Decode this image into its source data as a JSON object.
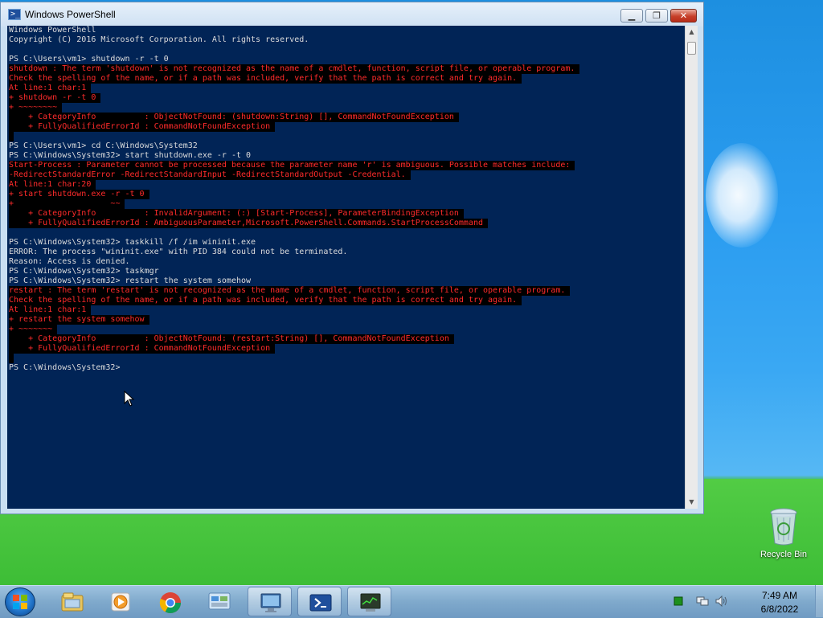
{
  "window": {
    "title": "Windows PowerShell",
    "minimize_symbol": "▁",
    "maximize_symbol": "❐",
    "close_symbol": "✕"
  },
  "console_lines": [
    {
      "text": "Windows PowerShell",
      "type": "out"
    },
    {
      "text": "Copyright (C) 2016 Microsoft Corporation. All rights reserved.",
      "type": "out"
    },
    {
      "text": "",
      "type": "out"
    },
    {
      "text": "PS C:\\Users\\vm1> shutdown -r -t 0",
      "type": "out"
    },
    {
      "text": "shutdown : The term 'shutdown' is not recognized as the name of a cmdlet, function, script file, or operable program.",
      "type": "err"
    },
    {
      "text": "Check the spelling of the name, or if a path was included, verify that the path is correct and try again.",
      "type": "err"
    },
    {
      "text": "At line:1 char:1",
      "type": "err"
    },
    {
      "text": "+ shutdown -r -t 0",
      "type": "err"
    },
    {
      "text": "+ ~~~~~~~~",
      "type": "err"
    },
    {
      "text": "    + CategoryInfo          : ObjectNotFound: (shutdown:String) [], CommandNotFoundException",
      "type": "err"
    },
    {
      "text": "    + FullyQualifiedErrorId : CommandNotFoundException",
      "type": "err"
    },
    {
      "text": "",
      "type": "err"
    },
    {
      "text": "PS C:\\Users\\vm1> cd C:\\Windows\\System32",
      "type": "out"
    },
    {
      "text": "PS C:\\Windows\\System32> start shutdown.exe -r -t 0",
      "type": "out"
    },
    {
      "text": "Start-Process : Parameter cannot be processed because the parameter name 'r' is ambiguous. Possible matches include:",
      "type": "err"
    },
    {
      "text": "-RedirectStandardError -RedirectStandardInput -RedirectStandardOutput -Credential.",
      "type": "err"
    },
    {
      "text": "At line:1 char:20",
      "type": "err"
    },
    {
      "text": "+ start shutdown.exe -r -t 0",
      "type": "err"
    },
    {
      "text": "+                    ~~",
      "type": "err"
    },
    {
      "text": "    + CategoryInfo          : InvalidArgument: (:) [Start-Process], ParameterBindingException",
      "type": "err"
    },
    {
      "text": "    + FullyQualifiedErrorId : AmbiguousParameter,Microsoft.PowerShell.Commands.StartProcessCommand",
      "type": "err"
    },
    {
      "text": "",
      "type": "out"
    },
    {
      "text": "PS C:\\Windows\\System32> taskkill /f /im wininit.exe",
      "type": "out"
    },
    {
      "text": "ERROR: The process \"wininit.exe\" with PID 384 could not be terminated.",
      "type": "out"
    },
    {
      "text": "Reason: Access is denied.",
      "type": "out"
    },
    {
      "text": "PS C:\\Windows\\System32> taskmgr",
      "type": "out"
    },
    {
      "text": "PS C:\\Windows\\System32> restart the system somehow",
      "type": "out"
    },
    {
      "text": "restart : The term 'restart' is not recognized as the name of a cmdlet, function, script file, or operable program.",
      "type": "err"
    },
    {
      "text": "Check the spelling of the name, or if a path was included, verify that the path is correct and try again.",
      "type": "err"
    },
    {
      "text": "At line:1 char:1",
      "type": "err"
    },
    {
      "text": "+ restart the system somehow",
      "type": "err"
    },
    {
      "text": "+ ~~~~~~~",
      "type": "err"
    },
    {
      "text": "    + CategoryInfo          : ObjectNotFound: (restart:String) [], CommandNotFoundException",
      "type": "err"
    },
    {
      "text": "    + FullyQualifiedErrorId : CommandNotFoundException",
      "type": "err"
    },
    {
      "text": "",
      "type": "err"
    },
    {
      "text": "PS C:\\Windows\\System32>",
      "type": "out"
    }
  ],
  "colors": {
    "console_bg": "#012456",
    "console_fg": "#dcdcdc",
    "error_fg": "#ff2b2b",
    "error_bg": "#000000"
  },
  "scrollbar": {
    "up_symbol": "▲",
    "down_symbol": "▼"
  },
  "desktop": {
    "recycle_bin_label": "Recycle Bin"
  },
  "taskbar": {
    "pinned": [
      {
        "name": "explorer-icon",
        "active": false
      },
      {
        "name": "media-player-icon",
        "active": false
      },
      {
        "name": "chrome-icon",
        "active": false
      },
      {
        "name": "control-panel-icon",
        "active": false
      },
      {
        "name": "remote-desktop-icon",
        "active": true
      },
      {
        "name": "powershell-icon",
        "active": true
      },
      {
        "name": "task-manager-icon",
        "active": true
      }
    ],
    "clock_time": "7:49 AM",
    "clock_date": "6/8/2022"
  }
}
